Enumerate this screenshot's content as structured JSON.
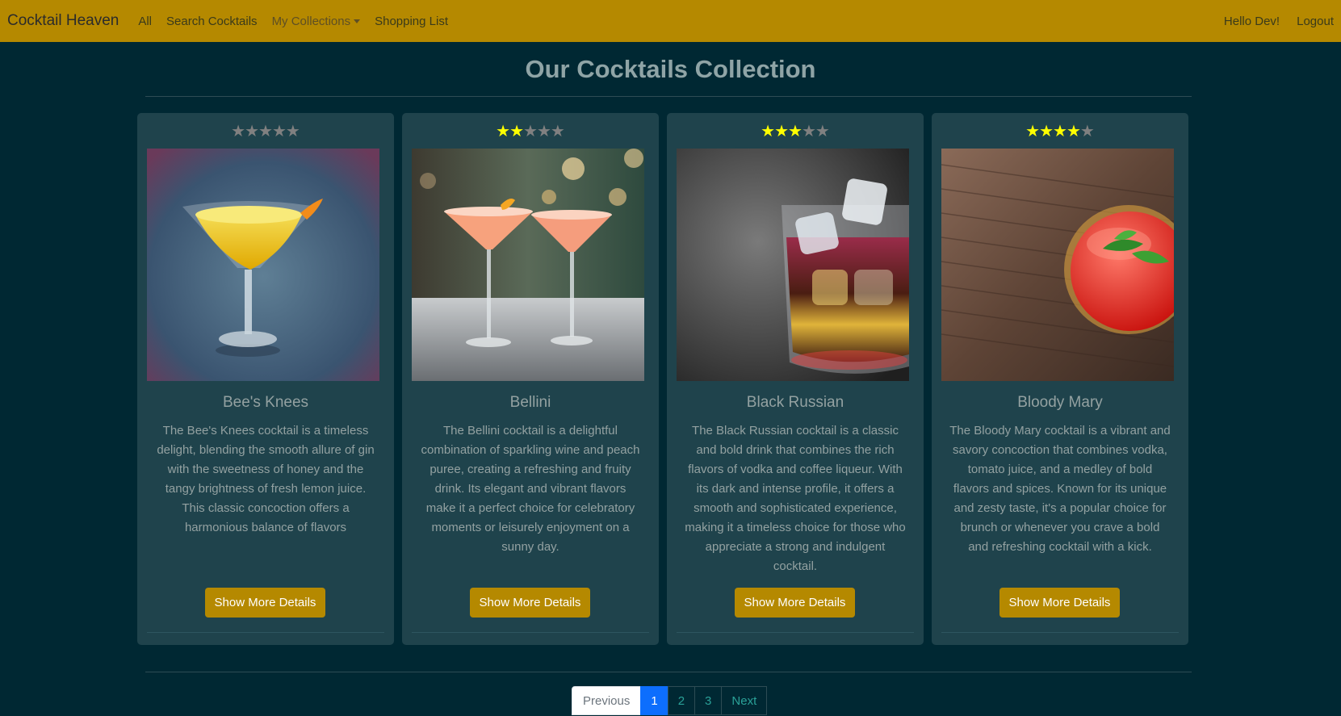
{
  "nav": {
    "brand": "Cocktail Heaven",
    "links": [
      "All",
      "Search Cocktails",
      "My Collections",
      "Shopping List"
    ],
    "greeting": "Hello Dev!",
    "logout": "Logout"
  },
  "page": {
    "title": "Our Cocktails Collection"
  },
  "cards": [
    {
      "rating": 0,
      "name": "Bee's Knees",
      "description": "The Bee's Knees cocktail is a timeless delight, blending the smooth allure of gin with the sweetness of honey and the tangy brightness of fresh lemon juice. This classic concoction offers a harmonious balance of flavors",
      "button": "Show More Details"
    },
    {
      "rating": 2,
      "name": "Bellini",
      "description": "The Bellini cocktail is a delightful combination of sparkling wine and peach puree, creating a refreshing and fruity drink. Its elegant and vibrant flavors make it a perfect choice for celebratory moments or leisurely enjoyment on a sunny day.",
      "button": "Show More Details"
    },
    {
      "rating": 3,
      "name": "Black Russian",
      "description": "The Black Russian cocktail is a classic and bold drink that combines the rich flavors of vodka and coffee liqueur. With its dark and intense profile, it offers a smooth and sophisticated experience, making it a timeless choice for those who appreciate a strong and indulgent cocktail.",
      "button": "Show More Details"
    },
    {
      "rating": 4,
      "name": "Bloody Mary",
      "description": "The Bloody Mary cocktail is a vibrant and savory concoction that combines vodka, tomato juice, and a medley of bold flavors and spices. Known for its unique and zesty taste, it's a popular choice for brunch or whenever you crave a bold and refreshing cocktail with a kick.",
      "button": "Show More Details"
    }
  ],
  "pagination": {
    "previous": "Previous",
    "pages": [
      "1",
      "2",
      "3"
    ],
    "active": "1",
    "next": "Next"
  },
  "colors": {
    "navbar": "#b58900",
    "background": "#002833",
    "card": "#1f434c",
    "star_on": "#ffff00",
    "star_off": "#808080",
    "active_page": "#0d6efd"
  }
}
